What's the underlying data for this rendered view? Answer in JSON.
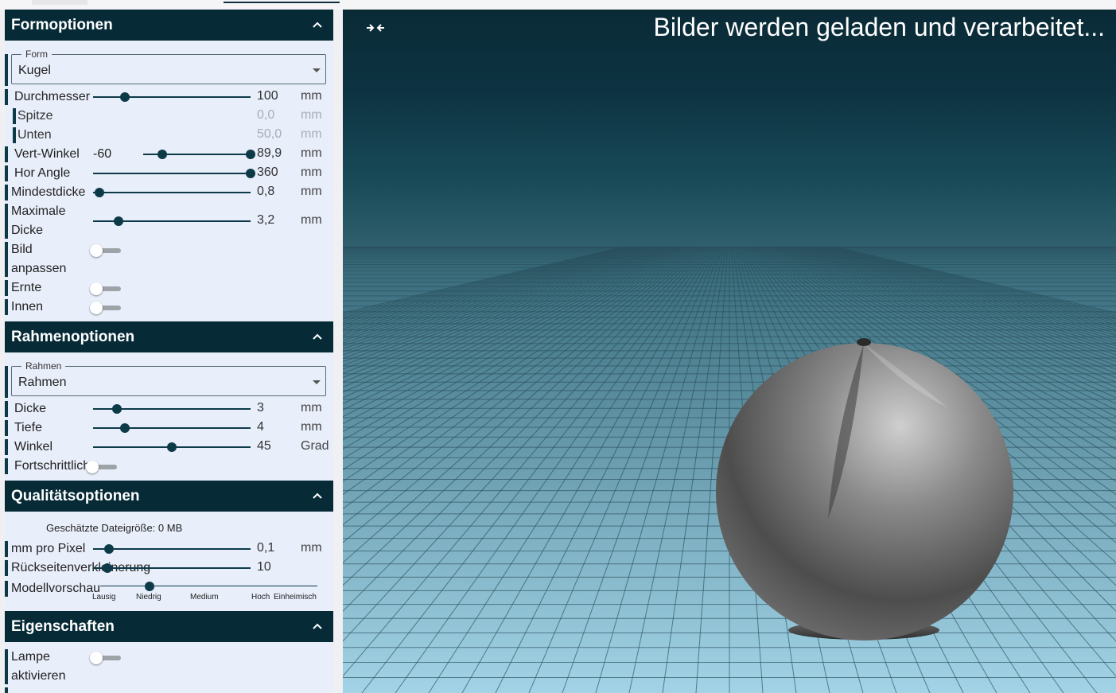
{
  "sections": {
    "form_options": "Formoptionen",
    "frame_options": "Rahmenoptionen",
    "quality_options": "Qualitätsoptionen",
    "properties": "Eigenschaften"
  },
  "form": {
    "select_legend": "Form",
    "select_value": "Kugel",
    "diameter": {
      "label": "Durchmesser",
      "value": "100",
      "unit": "mm",
      "fraction": 0.2
    },
    "tip": {
      "label": "Spitze",
      "value": "0,0",
      "unit": "mm"
    },
    "bottom": {
      "label": "Unten",
      "value": "50,0",
      "unit": "mm"
    },
    "vert_angle": {
      "label": "Vert-Winkel",
      "min_value": "-60",
      "max_value": "89,9",
      "unit": "mm",
      "low_fraction": 0.17,
      "high_fraction": 1.0
    },
    "hor_angle": {
      "label": "Hor Angle",
      "value": "360",
      "unit": "mm",
      "fraction": 1.0
    },
    "min_thickness": {
      "label": "Mindestdicke",
      "value": "0,8",
      "unit": "mm",
      "fraction": 0.04
    },
    "max_thickness": {
      "label_line1": "Maximale",
      "label_line2": "Dicke",
      "value": "3,2",
      "unit": "mm",
      "fraction": 0.16
    },
    "fit_image": {
      "label_line1": "Bild",
      "label_line2": "anpassen",
      "on": false
    },
    "crop": {
      "label": "Ernte",
      "on": false
    },
    "inside": {
      "label": "Innen",
      "on": false
    }
  },
  "frame": {
    "select_legend": "Rahmen",
    "select_value": "Rahmen",
    "thickness": {
      "label": "Dicke",
      "value": "3",
      "unit": "mm",
      "fraction": 0.15
    },
    "depth": {
      "label": "Tiefe",
      "value": "4",
      "unit": "mm",
      "fraction": 0.2
    },
    "angle": {
      "label": "Winkel",
      "value": "45",
      "unit": "Grad",
      "fraction": 0.5
    },
    "advanced": {
      "label": "Fortschrittlich",
      "on": false
    }
  },
  "quality": {
    "estimated_size": "Geschätzte Dateigröße: 0 MB",
    "mm_per_pixel": {
      "label": "mm pro Pixel",
      "value": "0,1",
      "unit": "mm",
      "fraction": 0.1
    },
    "back_reduction": {
      "label": "Rückseitenverkleinerung",
      "value": "10",
      "fraction": 0.09
    },
    "model_preview": {
      "label": "Modellvorschau",
      "ticks": [
        "Lausig",
        "Niedrig",
        "Medium",
        "Hoch",
        "Einheimisch"
      ],
      "selected": "Niedrig"
    }
  },
  "properties_section": {
    "lamp": {
      "label_line1": "Lampe",
      "label_line2": "aktivieren",
      "on": false
    }
  },
  "viewport": {
    "loading_text": "Bilder werden geladen und verarbeitet...",
    "compress_icon": "compress-arrows-icon"
  },
  "colors": {
    "header_bg": "#062b37",
    "panel_bg": "#e8eefa",
    "accent": "#0d3a48"
  }
}
